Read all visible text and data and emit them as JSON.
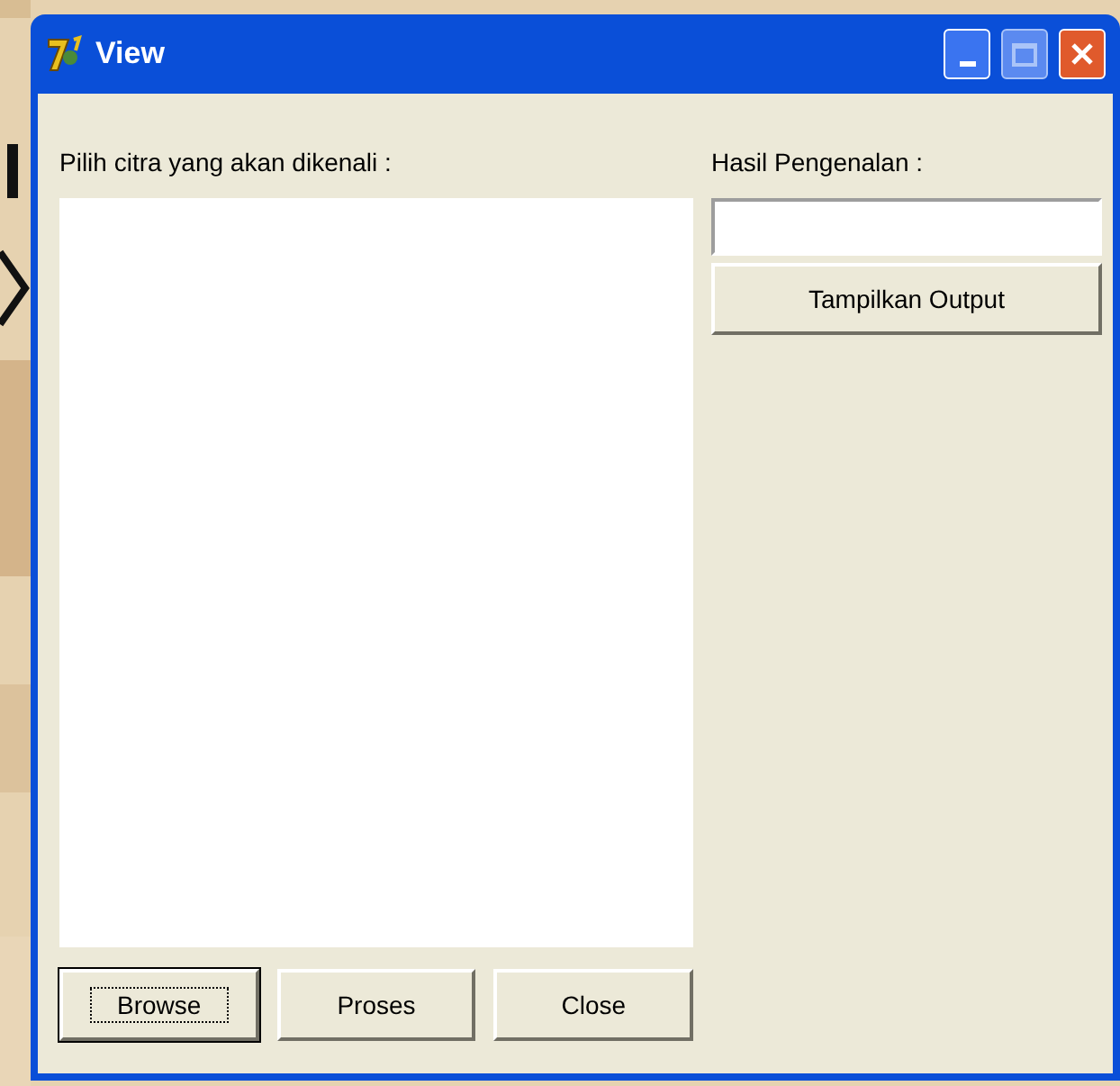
{
  "window": {
    "title": "View"
  },
  "left_panel": {
    "label": "Pilih citra yang akan dikenali :"
  },
  "right_panel": {
    "label": "Hasil Pengenalan :",
    "output_button": "Tampilkan Output"
  },
  "buttons": [
    {
      "label": "Browse",
      "focused": true
    },
    {
      "label": "Proses",
      "focused": false
    },
    {
      "label": "Close",
      "focused": false
    }
  ]
}
